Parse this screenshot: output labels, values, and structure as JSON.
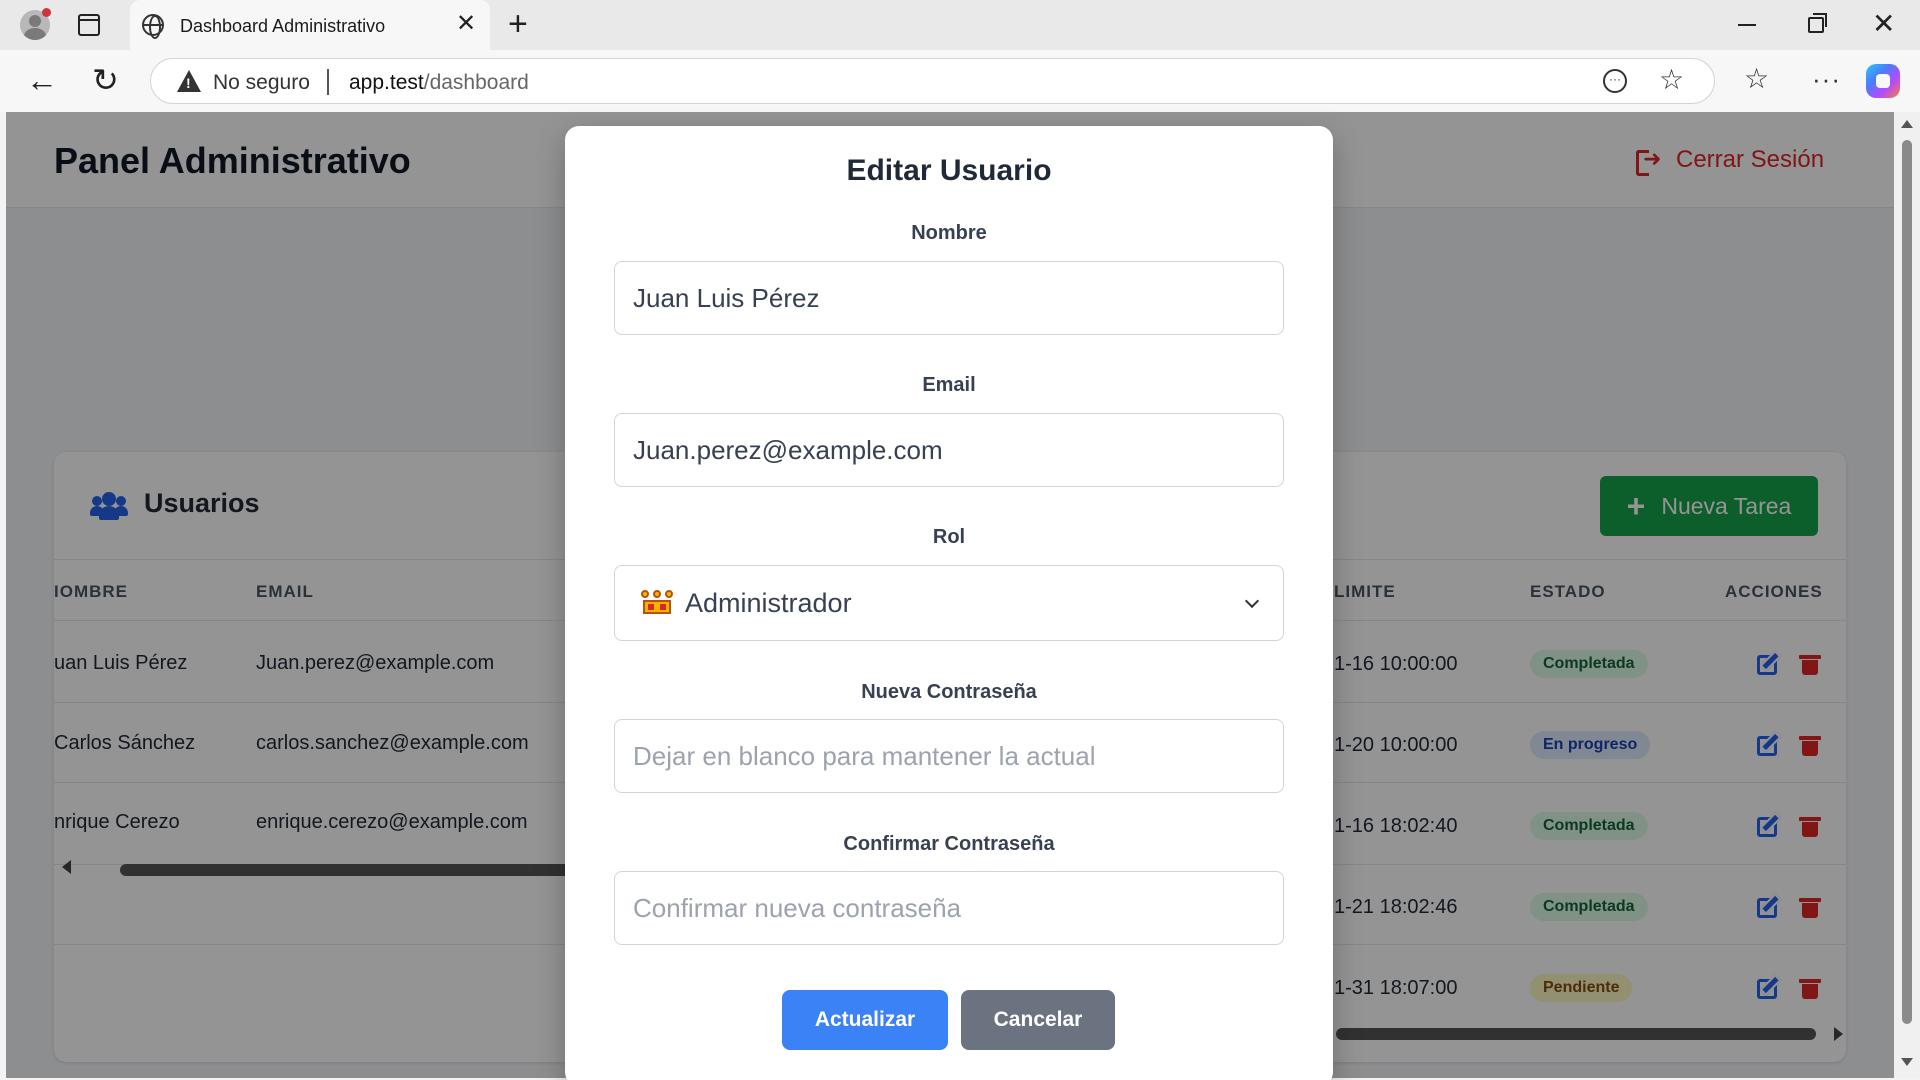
{
  "browser": {
    "tab_title": "Dashboard Administrativo",
    "url_warning": "No seguro",
    "url_host": "app.test",
    "url_path": "/dashboard"
  },
  "header": {
    "title": "Panel Administrativo",
    "logout_label": "Cerrar Sesión"
  },
  "users_card": {
    "title": "Usuarios",
    "new_task_label": "Nueva Tarea",
    "columns": [
      "IOMBRE",
      "EMAIL",
      "LIMITE",
      "ESTADO",
      "ACCIONES"
    ],
    "rows": [
      {
        "name": "uan Luis Pérez",
        "email": "Juan.perez@example.com"
      },
      {
        "name": "Carlos Sánchez",
        "email": "carlos.sanchez@example.com"
      },
      {
        "name": "nrique Cerezo",
        "email": "enrique.cerezo@example.com"
      }
    ],
    "task_rows": [
      {
        "limit": "1-16 10:00:00",
        "status": "Completada",
        "status_kind": "done"
      },
      {
        "limit": "1-20 10:00:00",
        "status": "En progreso",
        "status_kind": "progress"
      },
      {
        "limit": "1-16 18:02:40",
        "status": "Completada",
        "status_kind": "done"
      },
      {
        "limit": "1-21 18:02:46",
        "status": "Completada",
        "status_kind": "done"
      },
      {
        "limit": "1-31 18:07:00",
        "status": "Pendiente",
        "status_kind": "pending"
      }
    ]
  },
  "modal": {
    "title": "Editar Usuario",
    "name_label": "Nombre",
    "name_value": "Juan Luis Pérez",
    "email_label": "Email",
    "email_value": "Juan.perez@example.com",
    "role_label": "Rol",
    "role_icon": "crown-icon",
    "role_value": "Administrador",
    "password_label": "Nueva Contraseña",
    "password_placeholder": "Dejar en blanco para mantener la actual",
    "confirm_label": "Confirmar Contraseña",
    "confirm_placeholder": "Confirmar nueva contraseña",
    "update_label": "Actualizar",
    "cancel_label": "Cancelar"
  },
  "colors": {
    "primary": "#3b82f6",
    "success": "#16a34a",
    "danger": "#dc2626",
    "secondary": "#6b7280"
  }
}
